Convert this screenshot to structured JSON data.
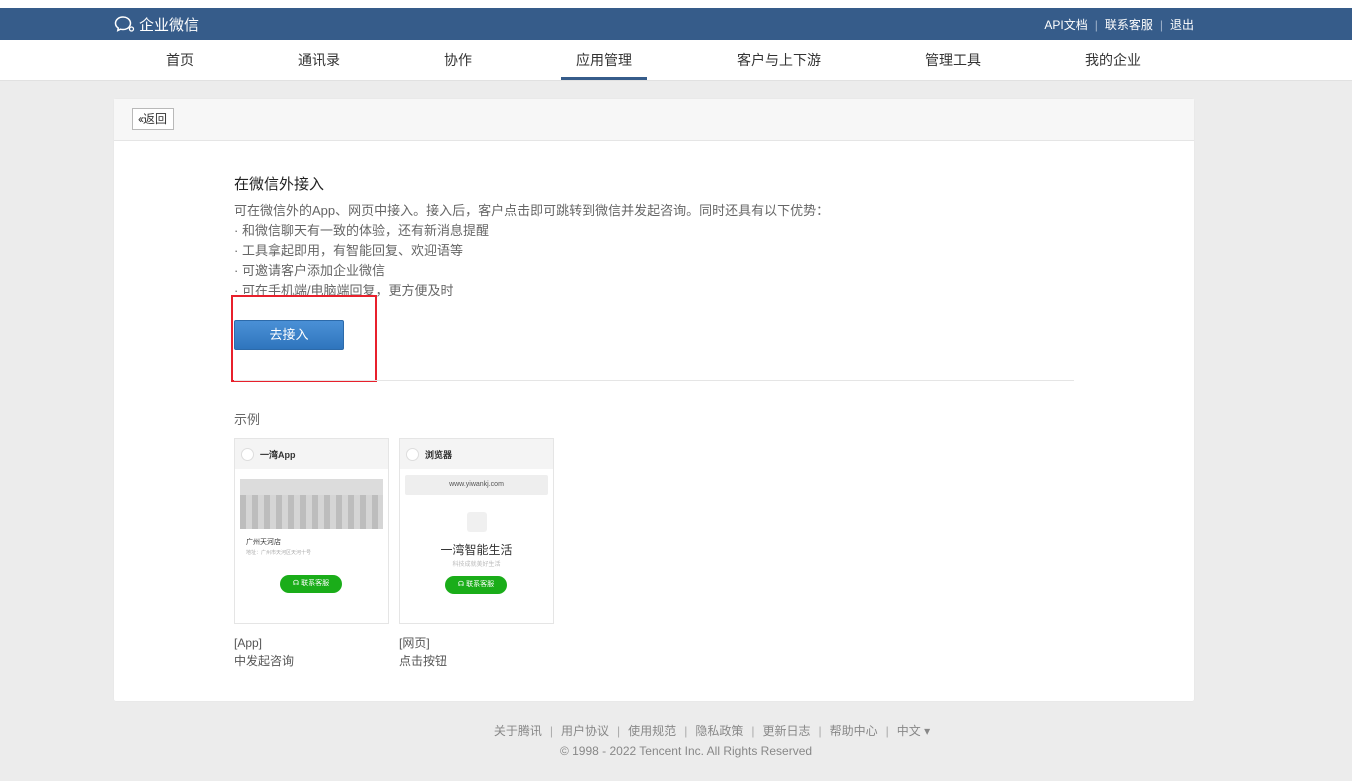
{
  "app": {
    "logo_text": "企业微信"
  },
  "toplinks": {
    "api": "API文档",
    "support": "联系客服",
    "logout": "退出"
  },
  "nav": {
    "tabs": [
      {
        "label": "首页"
      },
      {
        "label": "通讯录"
      },
      {
        "label": "协作"
      },
      {
        "label": "应用管理"
      },
      {
        "label": "客户与上下游"
      },
      {
        "label": "管理工具"
      },
      {
        "label": "我的企业"
      }
    ],
    "active": "应用管理"
  },
  "card": {
    "back_label": "返回",
    "title": "在微信外接入",
    "desc": "可在微信外的App、网页中接入。接入后，客户点击即可跳转到微信并发起咨询。同时还具有以下优势：",
    "bullets": [
      "· 和微信聊天有一致的体验，还有新消息提醒",
      "· 工具拿起即用，有智能回复、欢迎语等",
      "· 可邀请客户添加企业微信",
      "· 可在手机端/电脑端回复，更方便及时"
    ],
    "primary_button": "去接入",
    "example_label": "示例",
    "examples": [
      {
        "bar_title": "一湾App",
        "shop_name": "广州天河店",
        "shop_addr": "地址：广州市天河区天河十号",
        "button": "联系客服",
        "caption_line1": "[App]",
        "caption_line2": "中发起咨询"
      },
      {
        "bar_title": "浏览器",
        "url": "www.yiwankj.com",
        "brand_name": "一湾智能生活",
        "brand_sub": "科技成就美好生活",
        "button": "联系客服",
        "caption_line1": "[网页]",
        "caption_line2": "点击按钮"
      }
    ]
  },
  "footer": {
    "links": [
      "关于腾讯",
      "用户协议",
      "使用规范",
      "隐私政策",
      "更新日志",
      "帮助中心",
      "中文 ▾"
    ],
    "copyright": "© 1998 - 2022 Tencent Inc. All Rights Reserved"
  },
  "colors": {
    "header": "#365c8a",
    "primary": "#2f75bd",
    "highlight": "#e8202c",
    "green": "#1aad19"
  }
}
